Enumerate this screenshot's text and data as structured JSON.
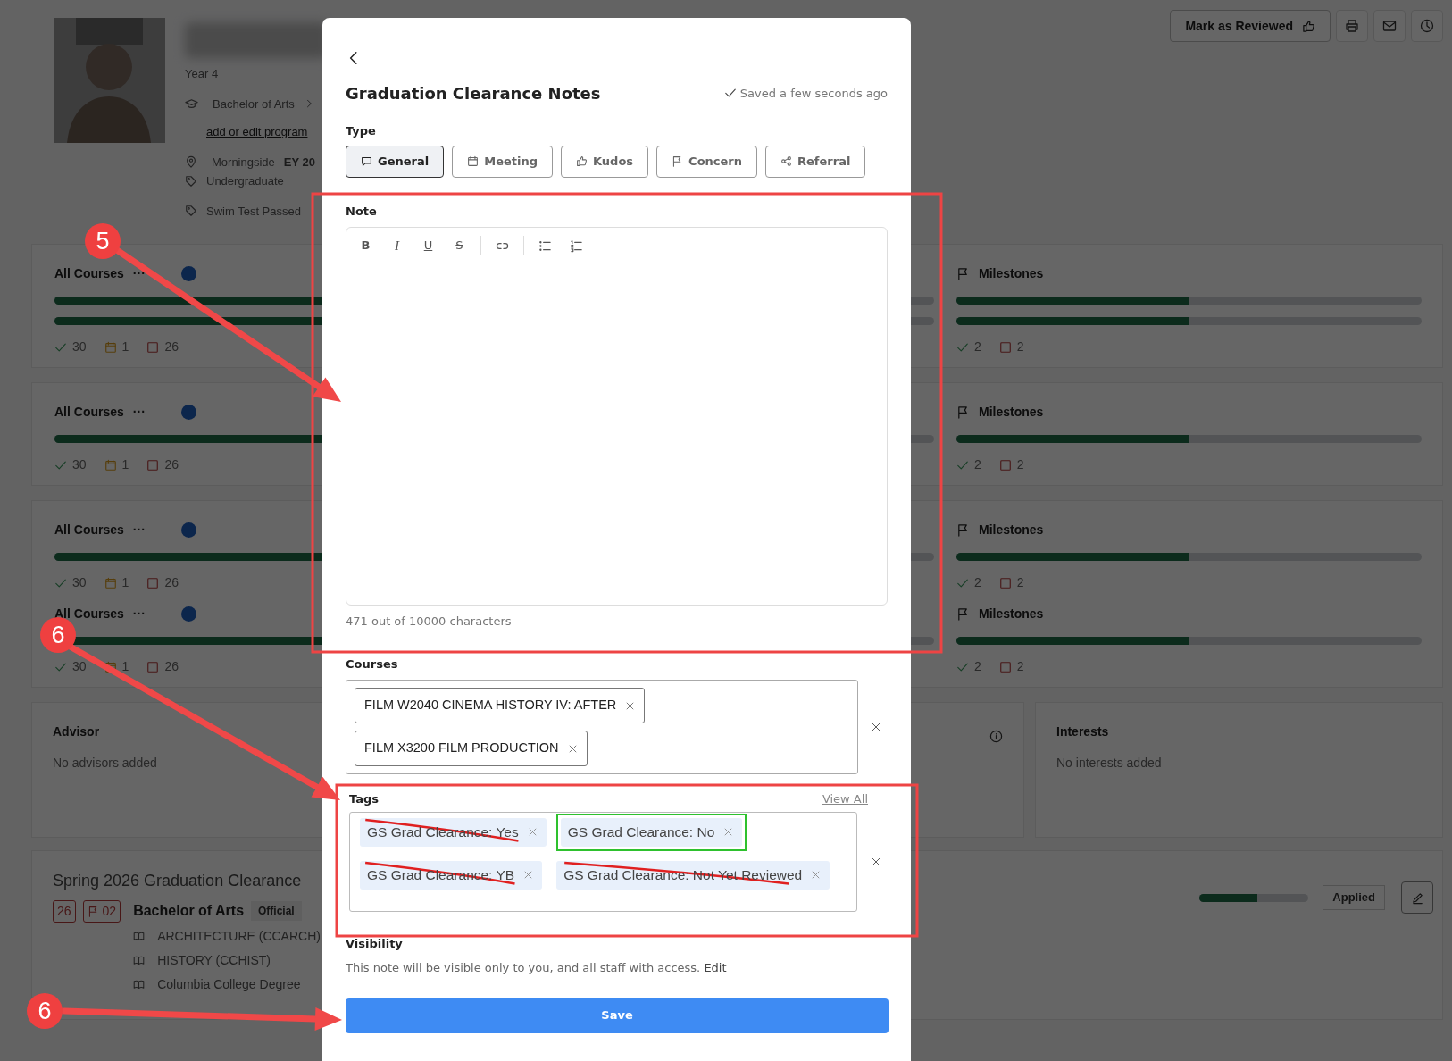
{
  "header": {
    "year": "Year 4",
    "program": "Bachelor of Arts",
    "program_link": "add or edit program",
    "campus": "Morningside",
    "campus_extra": "EY 20",
    "tags": [
      "Undergraduate",
      "Swim Test Passed"
    ]
  },
  "actions": {
    "review_button": "Mark as Reviewed"
  },
  "progress_cards": [
    {
      "rows": [
        {
          "title": "All Courses",
          "more": "···",
          "bars": [
            {
              "level": 0.85
            },
            {
              "level": 0.85
            }
          ],
          "completed": "30",
          "in_progress": "1",
          "remaining": "26",
          "milestones": {
            "title": "Milestones",
            "bars": [
              {
                "level": 0.5
              },
              {
                "level": 0.5
              }
            ],
            "completed": "2",
            "remaining": "2"
          }
        }
      ]
    },
    {
      "rows": [
        {
          "title": "All Courses",
          "more": "···",
          "bars": [
            {
              "level": 0.85
            }
          ],
          "completed": "30",
          "in_progress": "1",
          "remaining": "26",
          "milestones": {
            "title": "Milestones",
            "bars": [
              {
                "level": 0.5
              }
            ],
            "completed": "2",
            "remaining": "2"
          }
        }
      ]
    },
    {
      "rows": [
        {
          "title": "All Courses",
          "more": "···",
          "bars": [
            {
              "level": 0.85
            }
          ],
          "completed": "30",
          "in_progress": "1",
          "remaining": "26",
          "milestones": {
            "title": "Milestones",
            "bars": [
              {
                "level": 0.5
              }
            ],
            "completed": "2",
            "remaining": "2"
          }
        },
        {
          "title": "All Courses",
          "more": "···",
          "bars": [
            {
              "level": 0.85
            }
          ],
          "completed": "30",
          "in_progress": "1",
          "remaining": "26",
          "milestones": {
            "title": "Milestones",
            "bars": [
              {
                "level": 0.5
              }
            ],
            "completed": "2",
            "remaining": "2"
          }
        }
      ]
    }
  ],
  "profile_cards": [
    {
      "title": "Advisor",
      "empty_text": "No advisors added"
    },
    {
      "title": "Interests",
      "empty_text": "No interests added"
    }
  ],
  "degree_card": {
    "title": "Spring 2026 Graduation Clearance",
    "count_badge": "26",
    "flag_badge": "02",
    "program": "Bachelor of Arts",
    "program_tag": "Official",
    "requirements": [
      "ARCHITECTURE (CCARCH)",
      "HISTORY (CCHIST)",
      "Columbia College Degree"
    ],
    "progress": {
      "level": 0.53
    },
    "status": "Applied"
  },
  "note_modal": {
    "title": "Graduation Clearance Notes",
    "saved_status": "Saved a few seconds ago",
    "type_label": "Type",
    "types": [
      {
        "label": "General",
        "selected": true
      },
      {
        "label": "Meeting",
        "selected": false
      },
      {
        "label": "Kudos",
        "selected": false
      },
      {
        "label": "Concern",
        "selected": false
      },
      {
        "label": "Referral",
        "selected": false
      }
    ],
    "note_label": "Note",
    "format_buttons": [
      "B",
      "I",
      "U",
      "S"
    ],
    "char_count": "471 out of 10000 characters",
    "courses": {
      "label": "Courses",
      "items": [
        "FILM W2040 CINEMA HISTORY IV: AFTER",
        "FILM X3200 FILM PRODUCTION"
      ]
    },
    "tags": {
      "label": "Tags",
      "view_all": "View All",
      "items": [
        {
          "label": "GS Grad Clearance: Yes",
          "struck": true,
          "highlighted": false
        },
        {
          "label": "GS Grad Clearance: No",
          "struck": false,
          "highlighted": true
        },
        {
          "label": "GS Grad Clearance: YB",
          "struck": true,
          "highlighted": false
        },
        {
          "label": "GS Grad Clearance: Not Yet Reviewed",
          "struck": true,
          "highlighted": false
        }
      ]
    },
    "visibility": {
      "label": "Visibility",
      "text": "This note will be visible only to you, and all staff with access.",
      "link": "Edit"
    },
    "save_button": "Save"
  },
  "callouts": [
    {
      "number": "5"
    },
    {
      "number": "6"
    },
    {
      "number": "6"
    }
  ]
}
